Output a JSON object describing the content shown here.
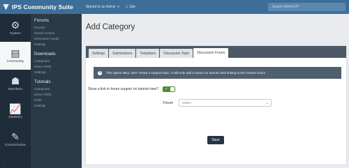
{
  "header": {
    "app_name": "IPS Community Suite",
    "signed_in": "Signed in as Admin",
    "site_link": "Site",
    "search_placeholder": "Search AdminCP"
  },
  "primary_nav": [
    {
      "label": "System",
      "icon": "gears-icon"
    },
    {
      "label": "Community",
      "icon": "document-icon"
    },
    {
      "label": "Members",
      "icon": "users-icon"
    },
    {
      "label": "Statistics",
      "icon": "chart-icon"
    },
    {
      "label": "Customization",
      "icon": "paintbrush-icon"
    }
  ],
  "secondary_nav": [
    {
      "title": "Forums",
      "items": [
        "Forums",
        "Saved Actions",
        "RSS/Atom Feeds",
        "Settings"
      ]
    },
    {
      "title": "Downloads",
      "items": [
        "Categories",
        "Extra Fields",
        "Settings"
      ]
    },
    {
      "title": "Tutorials",
      "items": [
        "Categories",
        "Extra Fields",
        "Tools",
        "Settings"
      ]
    }
  ],
  "page": {
    "title": "Add Category",
    "tabs": [
      "Settings",
      "Submissions",
      "Templates",
      "Discussion Topic",
      "Discussion Forum"
    ],
    "active_tab": "Discussion Forum",
    "notice": "This option WILL NOT create a support topic. It will only add a button on tutorial view linking to the chosen forum",
    "toggle_label": "Show a link to forum support on tutorial view?",
    "toggle_on": true,
    "forum_label": "Forum",
    "forum_value": "Select",
    "save_label": "Save"
  }
}
